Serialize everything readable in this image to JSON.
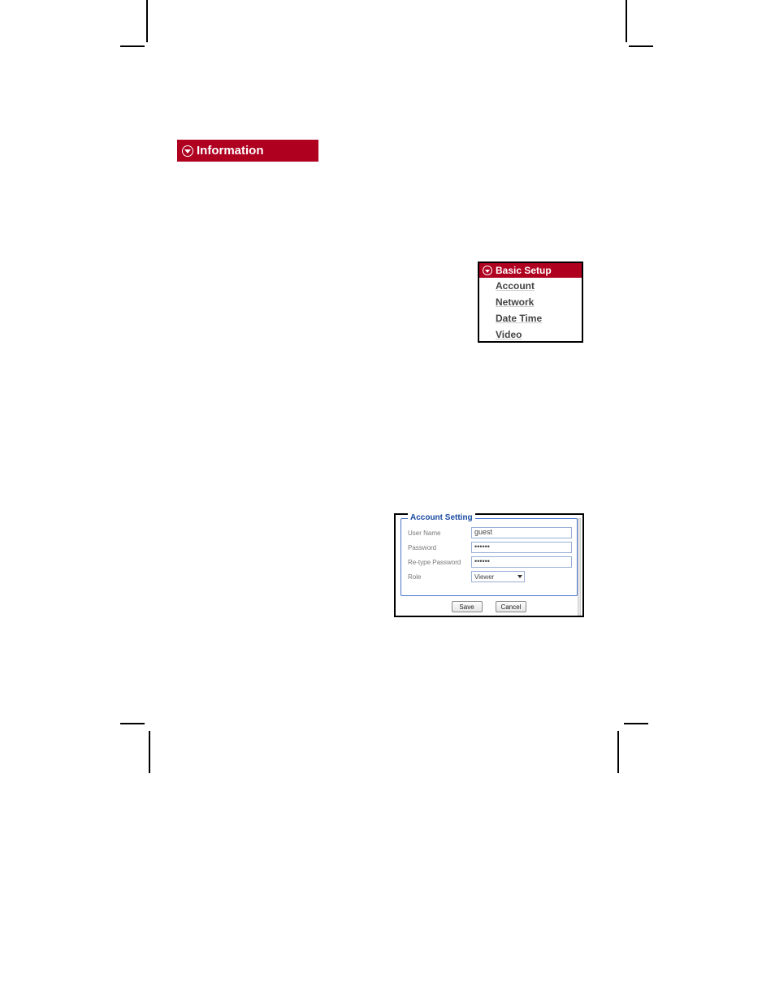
{
  "info_bar": {
    "label": "Information"
  },
  "basic_setup": {
    "title": "Basic Setup",
    "items": [
      {
        "label": "Account"
      },
      {
        "label": "Network"
      },
      {
        "label": "Date Time"
      },
      {
        "label": "Video"
      }
    ]
  },
  "account_setting": {
    "legend": "Account Setting",
    "fields": {
      "username_label": "User Name",
      "username_value": "guest",
      "password_label": "Password",
      "password_value": "••••••",
      "retype_label": "Re-type Password",
      "retype_value": "••••••",
      "role_label": "Role",
      "role_value": "Viewer"
    },
    "buttons": {
      "save": "Save",
      "cancel": "Cancel"
    }
  }
}
